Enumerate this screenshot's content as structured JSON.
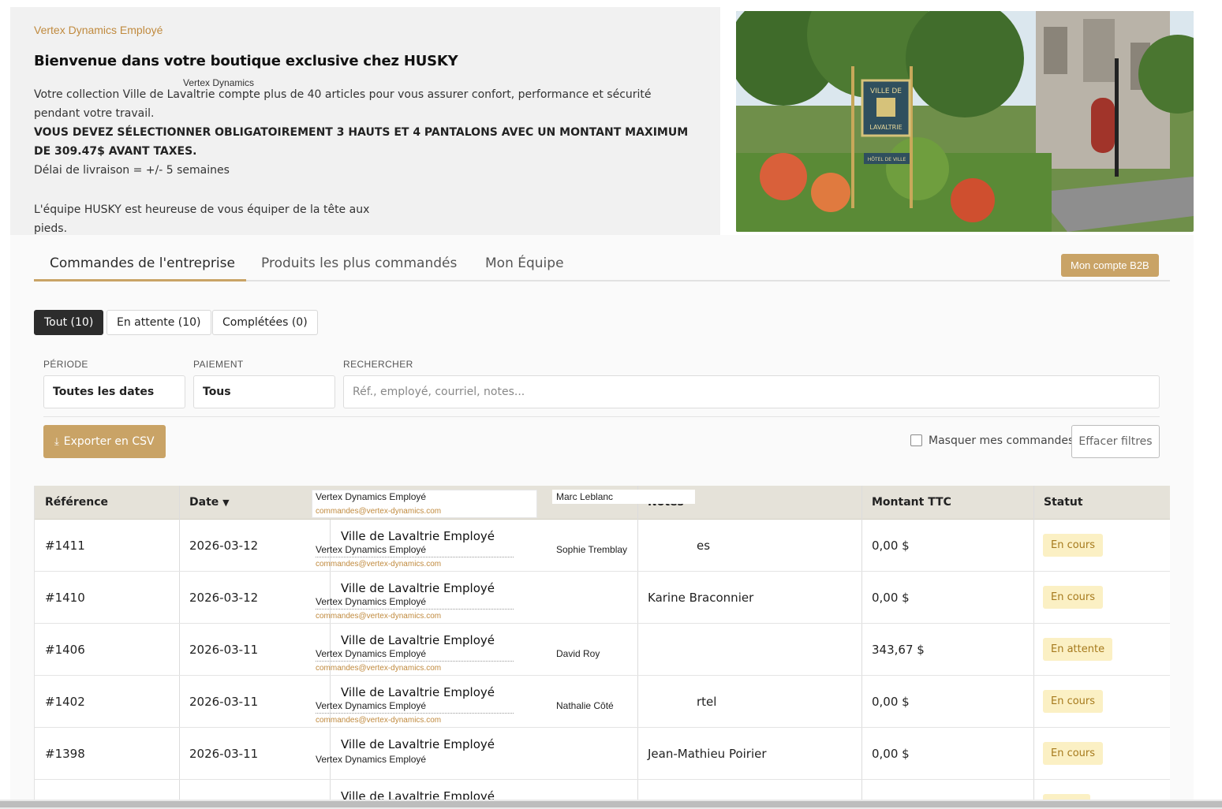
{
  "hero": {
    "eyebrow": "Vertex Dynamics Employé",
    "title": "Bienvenue dans votre boutique exclusive chez HUSKY",
    "overlay_label": "Vertex Dynamics",
    "paragraph1": "Votre collection Ville de Lavaltrie compte plus de 40 articles pour vous assurer confort, performance et sécurité pendant votre travail.",
    "paragraph2": "VOUS DEVEZ SÉLECTIONNER OBLIGATOIREMENT 3 HAUTS ET 4 PANTALONS AVEC UN MONTANT MAXIMUM DE 309.47$ AVANT TAXES.",
    "paragraph3": "Délai de livraison = +/- 5 semaines",
    "paragraph4": "L'équipe HUSKY est heureuse de vous équiper de la tête aux pieds.",
    "photo_sign_line1": "VILLE DE",
    "photo_sign_line2": "LAVALTRIE",
    "photo_sign_line3": "HÔTEL DE VILLE"
  },
  "tabs": [
    {
      "label": "Commandes de l'entreprise",
      "active": true
    },
    {
      "label": "Produits les plus commandés",
      "active": false
    },
    {
      "label": "Mon Équipe",
      "active": false
    }
  ],
  "b2b_button": "Mon compte B2B",
  "segments": [
    {
      "label": "Tout (10)",
      "active": true
    },
    {
      "label": "En attente (10)",
      "active": false
    },
    {
      "label": "Complétées (0)",
      "active": false
    }
  ],
  "filters": {
    "period_label": "PÉRIODE",
    "period_value": "Toutes les dates",
    "payment_label": "PAIEMENT",
    "payment_value": "Tous",
    "search_label": "RECHERCHER",
    "search_placeholder": "Réf., employé, courriel, notes..."
  },
  "actions": {
    "export": "Exporter en CSV",
    "hide_mine": "Masquer mes commandes",
    "clear": "Effacer filtres"
  },
  "table": {
    "headers": {
      "reference": "Référence",
      "date": "Date",
      "sort_icon": "▼",
      "notes": "Notes",
      "amount": "Montant TTC",
      "status": "Statut"
    },
    "header_overlay": {
      "employee": "Vertex Dynamics Employé",
      "email": "commandes@vertex-dynamics.com",
      "person": "Marc Leblanc"
    },
    "rows": [
      {
        "ref": "#1411",
        "date": "2026-03-12",
        "client": "Ville de Lavaltrie Employé",
        "employee": "Vertex Dynamics Employé",
        "email": "commandes@vertex-dynamics.com",
        "person": "Sophie Tremblay",
        "notes": "es",
        "amount": "0,00 $",
        "status": "En cours"
      },
      {
        "ref": "#1410",
        "date": "2026-03-12",
        "client": "Ville de Lavaltrie Employé",
        "employee": "Vertex Dynamics Employé",
        "email": "commandes@vertex-dynamics.com",
        "person": "",
        "notes": "Karine Braconnier",
        "amount": "0,00 $",
        "status": "En cours"
      },
      {
        "ref": "#1406",
        "date": "2026-03-11",
        "client": "Ville de Lavaltrie Employé",
        "employee": "Vertex Dynamics Employé",
        "email": "commandes@vertex-dynamics.com",
        "person": "David Roy",
        "notes": "",
        "amount": "343,67 $",
        "status": "En attente"
      },
      {
        "ref": "#1402",
        "date": "2026-03-11",
        "client": "Ville de Lavaltrie Employé",
        "employee": "Vertex Dynamics Employé",
        "email": "commandes@vertex-dynamics.com",
        "person": "Nathalie Côté",
        "notes": "rtel",
        "amount": "0,00 $",
        "status": "En cours"
      },
      {
        "ref": "#1398",
        "date": "2026-03-11",
        "client": "Ville de Lavaltrie Employé",
        "employee": "Vertex Dynamics Employé",
        "email": "",
        "person": "",
        "notes": "Jean-Mathieu Poirier",
        "amount": "0,00 $",
        "status": "En cours"
      },
      {
        "ref": "",
        "date": "",
        "client": "Ville de Lavaltrie Employé",
        "employee": "",
        "email": "",
        "person": "",
        "notes": "",
        "amount": "",
        "status": ""
      }
    ]
  },
  "colors": {
    "accent": "#c9a366",
    "eyebrow": "#c08a3e",
    "badge_bg": "#fbf0c4",
    "badge_text": "#a67a1d",
    "table_header_bg": "#e5e2d9"
  }
}
